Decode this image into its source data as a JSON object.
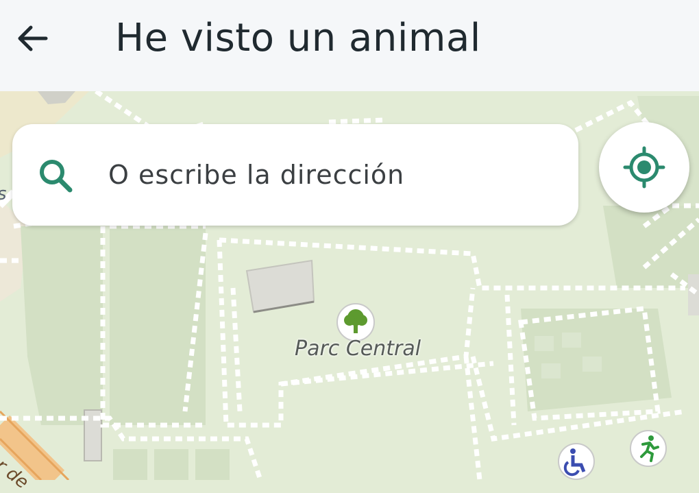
{
  "header": {
    "title": "He visto un animal",
    "back_icon": "arrow-left-icon"
  },
  "search": {
    "placeholder": "O escribe la dirección",
    "icon": "search-icon",
    "accent_color": "#2b8a6e"
  },
  "locate_button": {
    "icon": "my-location-icon",
    "color": "#2b8a6e"
  },
  "map": {
    "poi_park_label": "Parc Central",
    "street_label_fragment": "er de",
    "edge_label_fragment": "s",
    "park_icon": "tree-icon",
    "accessibility_icon": "wheelchair-icon",
    "sport_icon": "running-person-icon",
    "park_color": "#e3ecd6",
    "path_color": "#ffffff"
  }
}
